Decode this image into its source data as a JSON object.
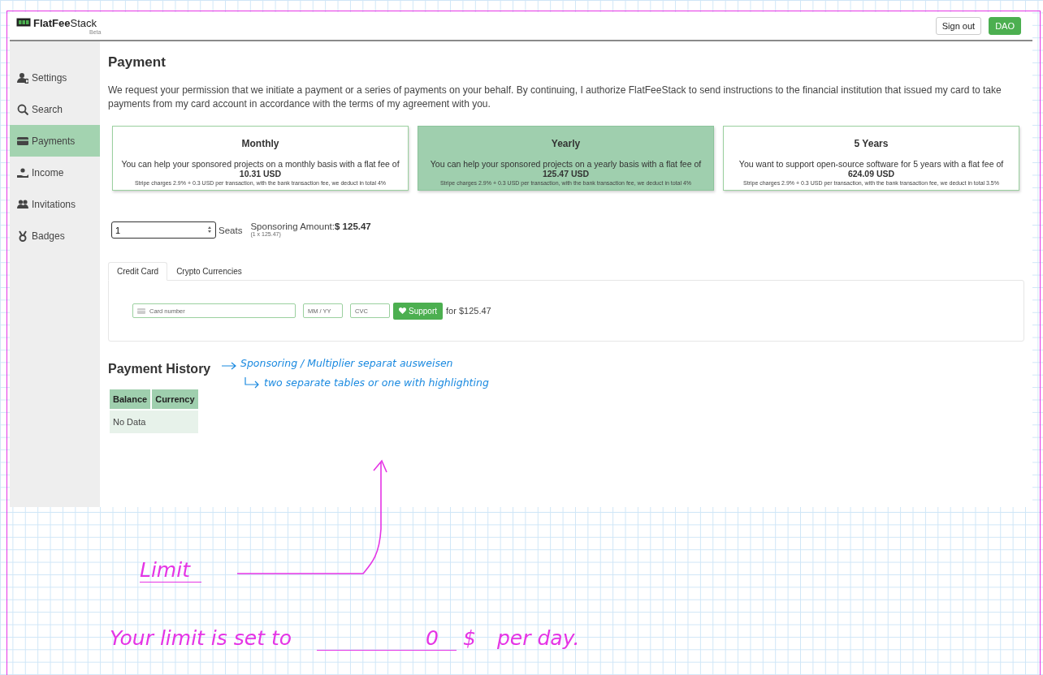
{
  "header": {
    "logo": "**FlatFee**Stack",
    "logo_badge": "Beta",
    "buttons": [
      {
        "label": "Sign out",
        "kind": "outline"
      },
      {
        "label": "DAO",
        "kind": "primary"
      }
    ]
  },
  "sidebar": {
    "items": [
      {
        "label": "Settings",
        "selected": false
      },
      {
        "label": "Search",
        "selected": false
      },
      {
        "label": "Payments",
        "selected": true
      },
      {
        "label": "Income",
        "selected": false
      },
      {
        "label": "Invitations",
        "selected": false
      },
      {
        "label": "Badges",
        "selected": false
      }
    ]
  },
  "page": {
    "title": "Payment",
    "intro": "We request your permission that we initiate a payment or a series of payments on your behalf. By continuing, I authorize FlatFeeStack to send instructions to the financial institution that issued my card to take payments from my card account in accordance with the terms of my agreement with you."
  },
  "plans": [
    {
      "title": "Monthly",
      "text": "You can help your sponsored projects on a monthly basis with a flat fee of **10.31 USD**",
      "note": "Stripe charges 2.9% + 0.3 USD per transaction, with the bank transaction fee, we deduct in total 4%",
      "selected": false
    },
    {
      "title": "Yearly",
      "text": "You can help your sponsored projects on a yearly basis with a flat fee of **125.47 USD**",
      "note": "Stripe charges 2.9% + 0.3 USD per transaction, with the bank transaction fee, we deduct in total 4%",
      "selected": true
    },
    {
      "title": "5 Years",
      "text": "You want to support open-source software for 5 years with a flat fee of **624.09 USD**",
      "note": "Stripe charges 2.9% + 0.3 USD per transaction, with the bank transaction fee, we deduct in total 3.5%",
      "selected": false
    }
  ],
  "seats": {
    "value": "1",
    "label": "Seats",
    "amount_label": "Sponsoring Amount:",
    "amount": "$ 125.47",
    "amount_note": "(1 x 125.47)"
  },
  "payment_tabs": [
    {
      "label": "Credit Card",
      "selected": true
    },
    {
      "label": "Crypto Currencies",
      "selected": false
    }
  ],
  "card_form": {
    "card_placeholder": "Card number",
    "expiry_placeholder": "MM / YY",
    "cvc_placeholder": "CVC",
    "button": "Support",
    "total": "for $125.47"
  },
  "history": {
    "title": "Payment History",
    "columns": [
      "Balance",
      "Currency"
    ],
    "empty": "No Data"
  },
  "annotations": {
    "history_note_1": "Sponsoring / Multiplier   separat   ausweisen",
    "history_note_2": "two separate tables or one with highlighting",
    "limit_title": "Limit",
    "limit_text": "Your limit is set to",
    "limit_value": "0",
    "limit_unit": "$",
    "limit_period": "per day."
  }
}
